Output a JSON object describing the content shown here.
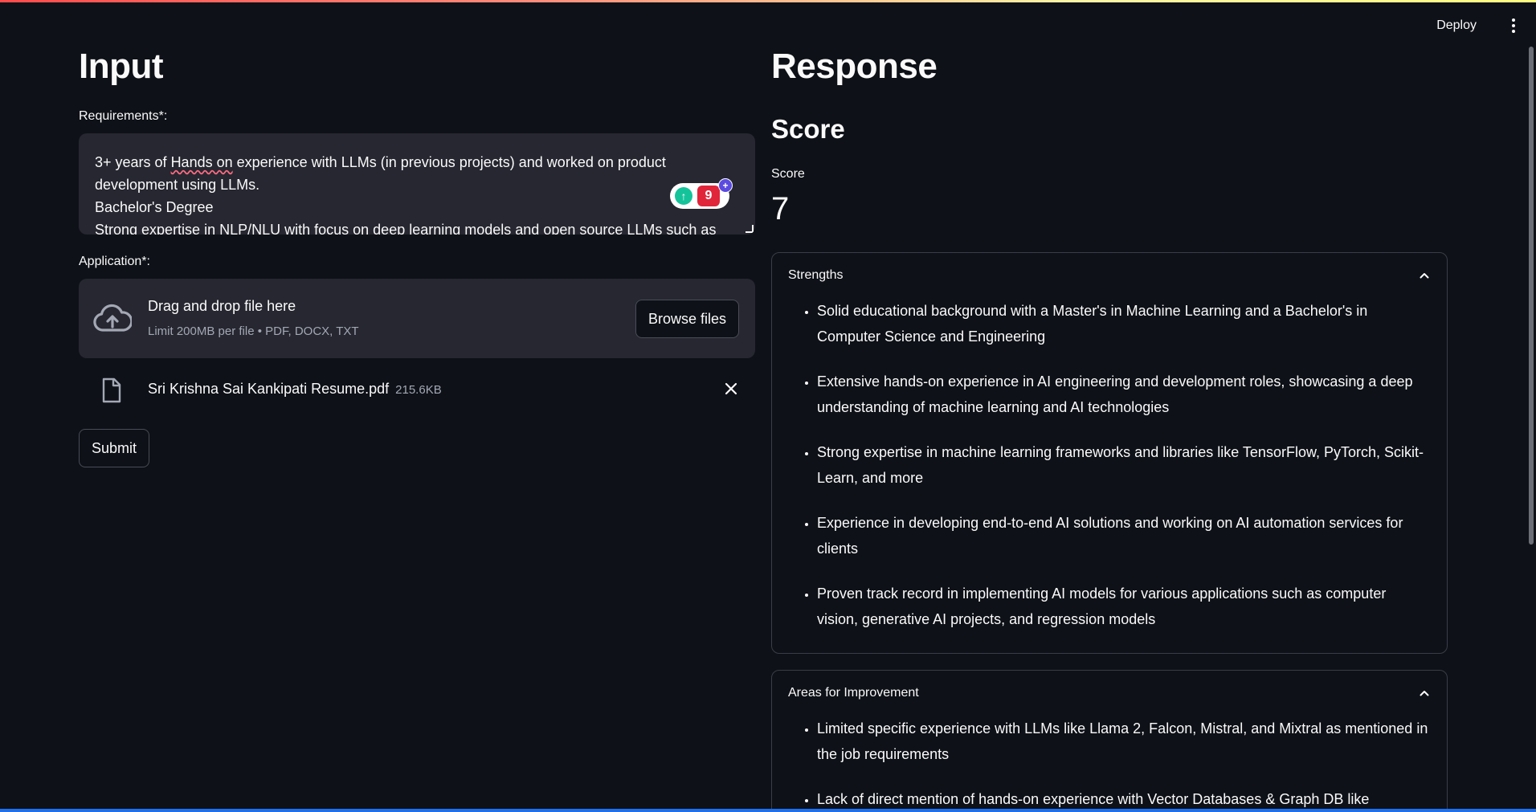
{
  "header": {
    "deploy_label": "Deploy"
  },
  "input": {
    "title": "Input",
    "requirements_label": "Requirements*:",
    "requirements_lines": [
      "3+ years of ",
      "Hands on",
      " experience with LLMs (in previous projects) and worked on product development using LLMs.",
      "Bachelor's Degree",
      "Strong expertise in NLP/NLU with focus on deep learning models and open source LLMs such as"
    ],
    "grammar_badge_count": "9",
    "application_label": "Application*:",
    "dropzone": {
      "title": "Drag and drop file here",
      "subtitle": "Limit 200MB per file • PDF, DOCX, TXT",
      "browse_label": "Browse files"
    },
    "file": {
      "name": "Sri Krishna Sai Kankipati Resume.pdf",
      "size": "215.6KB"
    },
    "submit_label": "Submit"
  },
  "response": {
    "title": "Response",
    "score_heading": "Score",
    "score_metric_label": "Score",
    "score_value": "7",
    "strengths": {
      "title": "Strengths",
      "items": [
        "Solid educational background with a Master's in Machine Learning and a Bachelor's in Computer Science and Engineering",
        "Extensive hands-on experience in AI engineering and development roles, showcasing a deep understanding of machine learning and AI technologies",
        "Strong expertise in machine learning frameworks and libraries like TensorFlow, PyTorch, Scikit-Learn, and more",
        "Experience in developing end-to-end AI solutions and working on AI automation services for clients",
        "Proven track record in implementing AI models for various applications such as computer vision, generative AI projects, and regression models"
      ]
    },
    "improvement": {
      "title": "Areas for Improvement",
      "items": [
        "Limited specific experience with LLMs like Llama 2, Falcon, Mistral, and Mixtral as mentioned in the job requirements",
        "Lack of direct mention of hands-on experience with Vector Databases & Graph DB like"
      ]
    }
  },
  "colors": {
    "background": "#0e1117",
    "input_bg": "#262730",
    "text": "#fafafa",
    "muted": "#a3a8b4",
    "border": "#3a3d47"
  },
  "icons": [
    "menu-icon",
    "cloud-upload-icon",
    "file-icon",
    "close-icon",
    "chevron-up-icon",
    "grammarly-icon"
  ]
}
